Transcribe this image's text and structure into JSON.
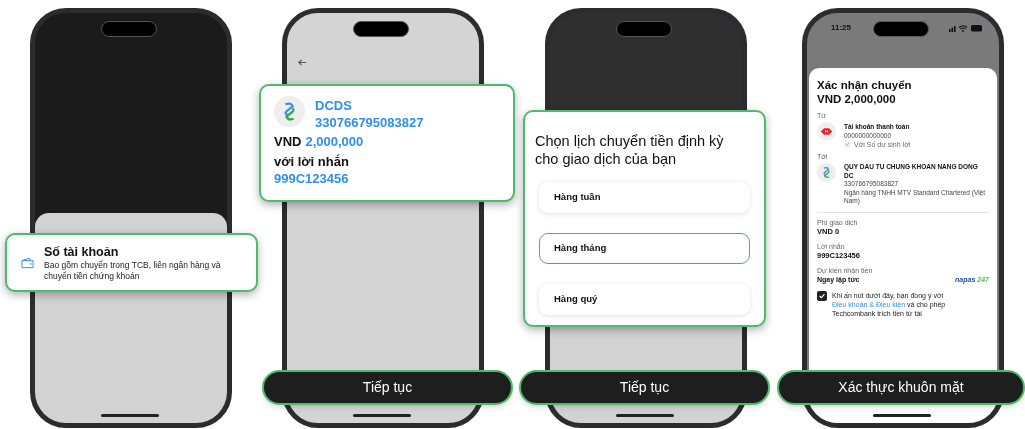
{
  "panels": [
    {
      "kind": "transfer_method",
      "callout": {
        "title": "Số tài khoản",
        "description": "Bao gồm chuyển trong TCB, liên ngân hàng và chuyển tiền chứng khoán"
      }
    },
    {
      "kind": "recipient",
      "callout": {
        "name": "DCDS",
        "account": "330766795083827",
        "currency": "VND",
        "amount": "2,000,000",
        "message_label": "với lời nhắn",
        "message": "999C123456"
      },
      "button": "Tiếp tục"
    },
    {
      "kind": "schedule",
      "callout": {
        "title": "Chọn lịch chuyển tiền định kỳ cho giao dịch của bạn",
        "options": [
          {
            "label": "Hàng tuần",
            "selected": false
          },
          {
            "label": "Hàng tháng",
            "selected": true
          },
          {
            "label": "Hàng quý",
            "selected": false
          }
        ]
      },
      "button": "Tiếp tục"
    },
    {
      "kind": "confirm",
      "status_time": "11:25",
      "title": "Xác nhận chuyển",
      "amount": "VND 2,000,000",
      "from_label": "Từ",
      "from": {
        "name": "Tài khoản thanh toán",
        "number": "0000000000000",
        "link_text": "Với Số dư sinh lời"
      },
      "to_label": "Tới",
      "to": {
        "name": "QUY DAU TU CHUNG KHOAN NANG DONG DC",
        "number": "330766795083827",
        "bank": "Ngân hàng TNHH MTV Standard Chartered (Việt Nam)"
      },
      "fee_label": "Phí giao dịch",
      "fee": "VND 0",
      "message_label": "Lời nhắn",
      "message": "999C123456",
      "eta_label": "Dự kiến nhận tiền",
      "eta": "Ngay lập tức",
      "napas": [
        "napas",
        "247"
      ],
      "consent": {
        "checked": true,
        "text": "Khi ấn nút dưới đây, bạn đồng ý với",
        "link": "Điều khoản & Điều kiện",
        "rest": "và cho phép Techcombank trích tiền từ tài"
      },
      "button": "Xác thực khuôn mặt"
    }
  ]
}
